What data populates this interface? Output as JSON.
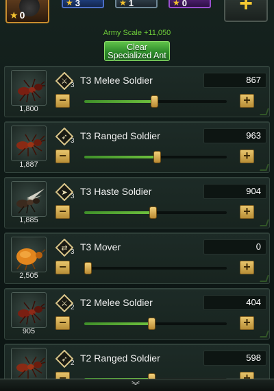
{
  "top": {
    "hero_count": "0",
    "chips": [
      {
        "value": "3",
        "color": "#4b6fc6"
      },
      {
        "value": "1",
        "color": "#6e8796"
      },
      {
        "value": "0",
        "color": "#9a4fd0"
      }
    ],
    "plus_icon": "plus-icon"
  },
  "army_scale": "Army Scale +11,050",
  "clear_button": {
    "line1": "Clear",
    "line2": "Specialized Ant"
  },
  "ants": [
    {
      "name": "T3 Melee Soldier",
      "tier": "3",
      "power": "1,800",
      "qty": "867",
      "fill": 0.49,
      "type": "melee"
    },
    {
      "name": "T3 Ranged Soldier",
      "tier": "3",
      "power": "1,887",
      "qty": "963",
      "fill": 0.51,
      "type": "ranged"
    },
    {
      "name": "T3 Haste Soldier",
      "tier": "3",
      "power": "1,885",
      "qty": "904",
      "fill": 0.48,
      "type": "haste"
    },
    {
      "name": "T3 Mover",
      "tier": "3",
      "power": "2,505",
      "qty": "0",
      "fill": 0.0,
      "type": "mover"
    },
    {
      "name": "T2 Melee Soldier",
      "tier": "2",
      "power": "905",
      "qty": "404",
      "fill": 0.47,
      "type": "melee"
    },
    {
      "name": "T2 Ranged Soldier",
      "tier": "2",
      "power": "",
      "qty": "598",
      "fill": 0.47,
      "type": "ranged"
    }
  ],
  "colors": {
    "accent_green": "#6fcf3a",
    "button_gold": "#e8c56c"
  }
}
